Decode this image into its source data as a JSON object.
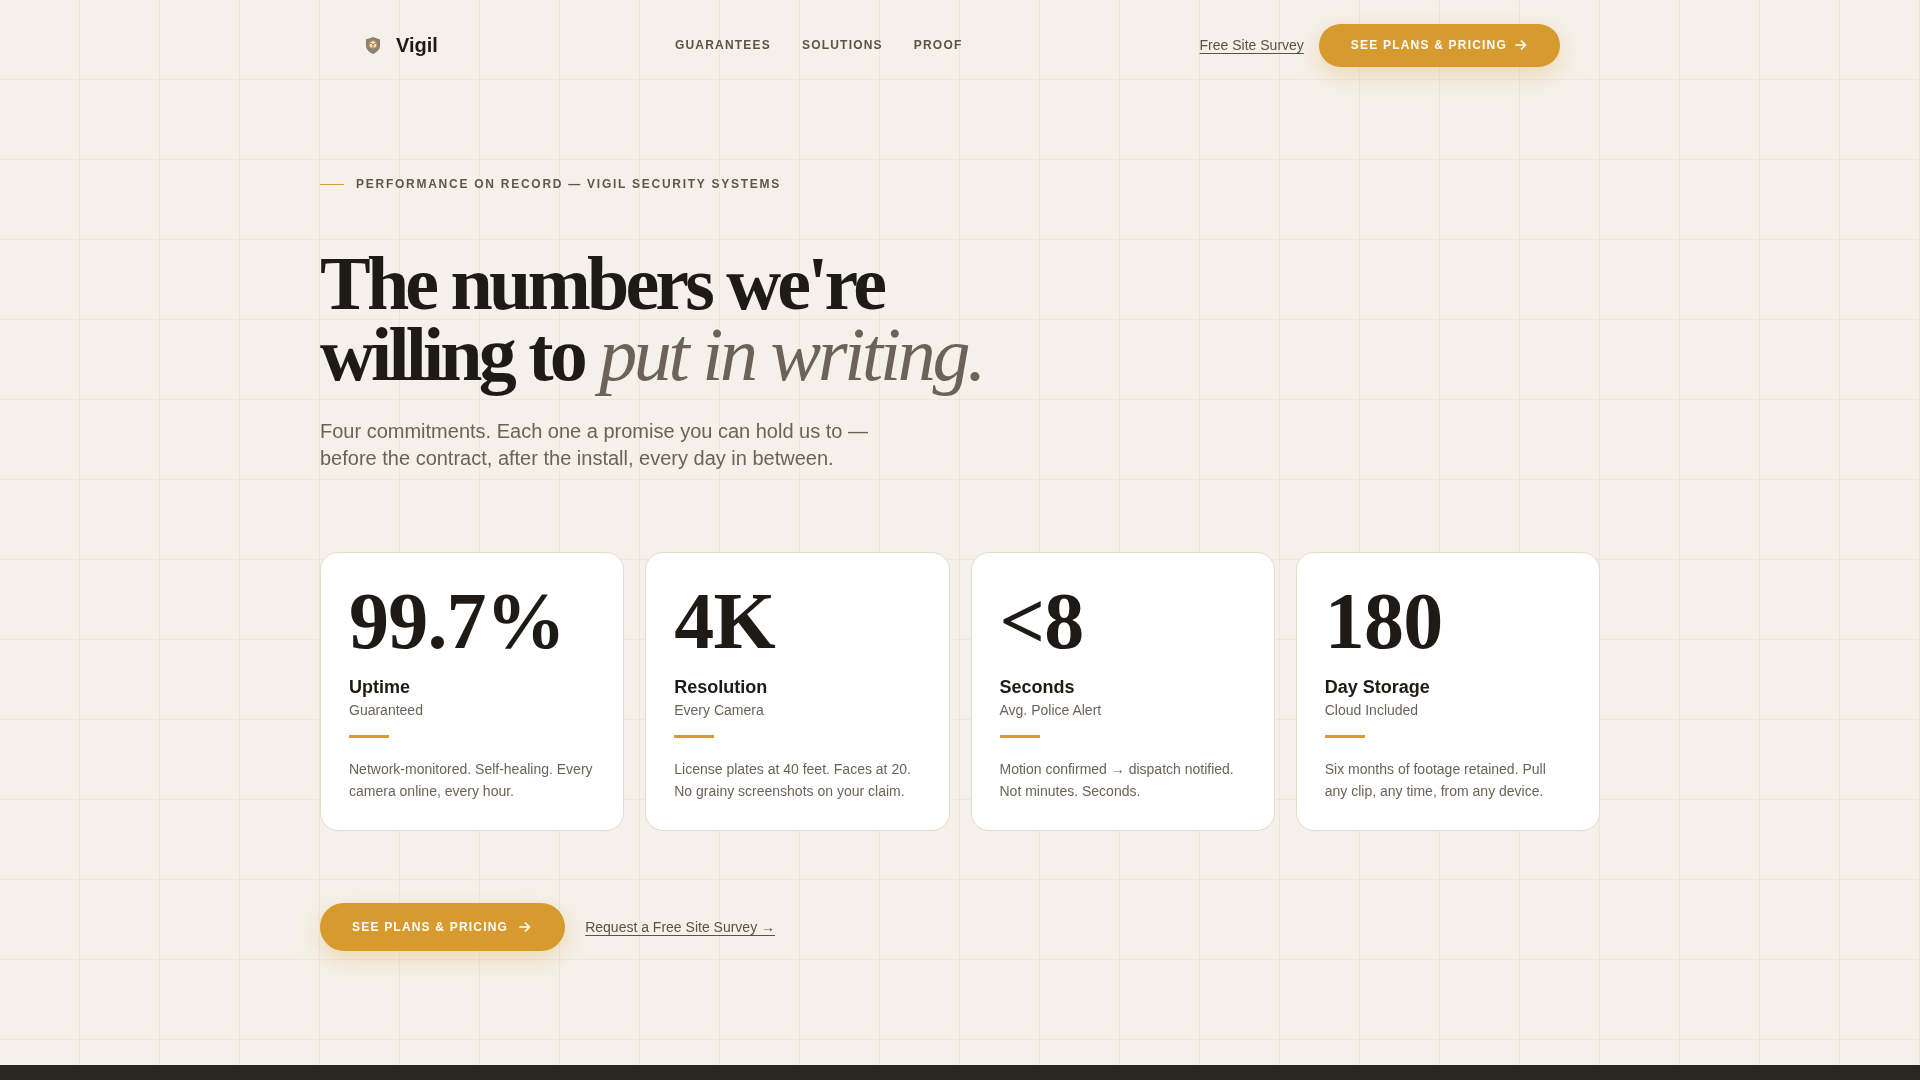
{
  "nav": {
    "brand": "Vigil",
    "links": [
      "GUARANTEES",
      "SOLUTIONS",
      "PROOF"
    ],
    "survey_link": "Free Site Survey",
    "cta": "SEE PLANS & PRICING"
  },
  "hero": {
    "eyebrow": "PERFORMANCE ON RECORD — VIGIL SECURITY SYSTEMS",
    "headline": "The numbers we're willing to *put in writing.*",
    "subtitle": "Four commitments. Each one a promise you can hold us to — before the contract, after the install, every day in between."
  },
  "stats": [
    {
      "value": "99.7%",
      "label": "Uptime",
      "sublabel": "Guaranteed",
      "description": "Network-monitored. Self-healing. Every camera online, every hour."
    },
    {
      "value": "4K",
      "label": "Resolution",
      "sublabel": "Every Camera",
      "description": "License plates at 40 feet. Faces at 20. No grainy screenshots on your claim."
    },
    {
      "value": "<8",
      "label": "Seconds",
      "sublabel": "Avg. Police Alert",
      "description": "Motion confirmed → dispatch notified. Not minutes. Seconds."
    },
    {
      "value": "180",
      "label": "Day Storage",
      "sublabel": "Cloud Included",
      "description": "Six months of footage retained. Pull any clip, any time, from any device."
    }
  ],
  "cta": {
    "primary": "SEE PLANS & PRICING",
    "secondary": "Request a Free Site Survey →"
  }
}
